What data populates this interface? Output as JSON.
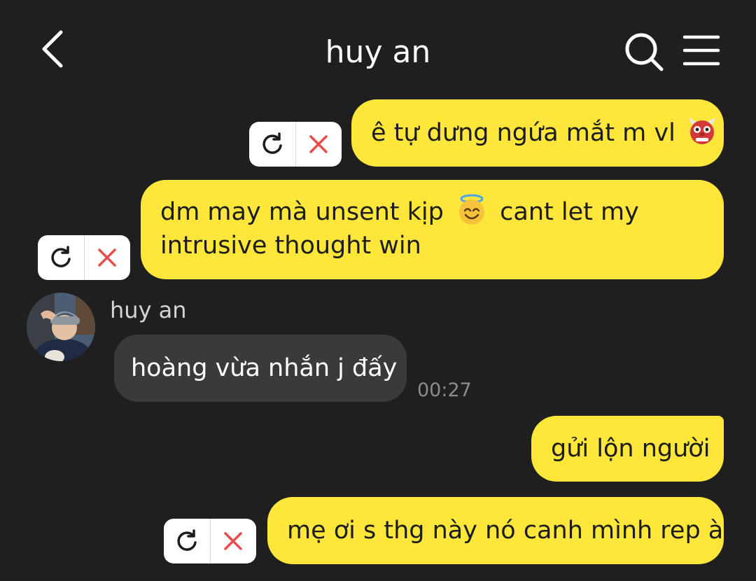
{
  "header": {
    "title": "huy an",
    "back_icon": "back-chevron-icon",
    "search_icon": "search-icon",
    "menu_icon": "hamburger-menu-icon"
  },
  "colors": {
    "background": "#1f1f1f",
    "outgoing_bubble": "#fee73a",
    "incoming_bubble": "#3a3a3a",
    "error_icon": "#e84c4c"
  },
  "messages": [
    {
      "direction": "out",
      "text": "ê tự dưng ngứa mắt m vl",
      "emoji": "ogre-emoji",
      "failed": true
    },
    {
      "direction": "out",
      "line1": "dm may mà unsent kịp",
      "line1_after": "cant let my",
      "line2": "intrusive thought win",
      "emoji": "smiling-face-with-halo-emoji",
      "failed": true
    },
    {
      "direction": "in",
      "sender": "huy an",
      "text": "hoàng vừa nhắn j đấy",
      "time": "00:27"
    },
    {
      "direction": "out",
      "text": "gửi lộn người",
      "failed": false
    },
    {
      "direction": "out",
      "text": "mẹ ơi s thg này nó canh mình rep à",
      "failed": true
    }
  ],
  "fail_actions": {
    "retry_icon": "retry-icon",
    "delete_icon": "delete-x-icon"
  }
}
